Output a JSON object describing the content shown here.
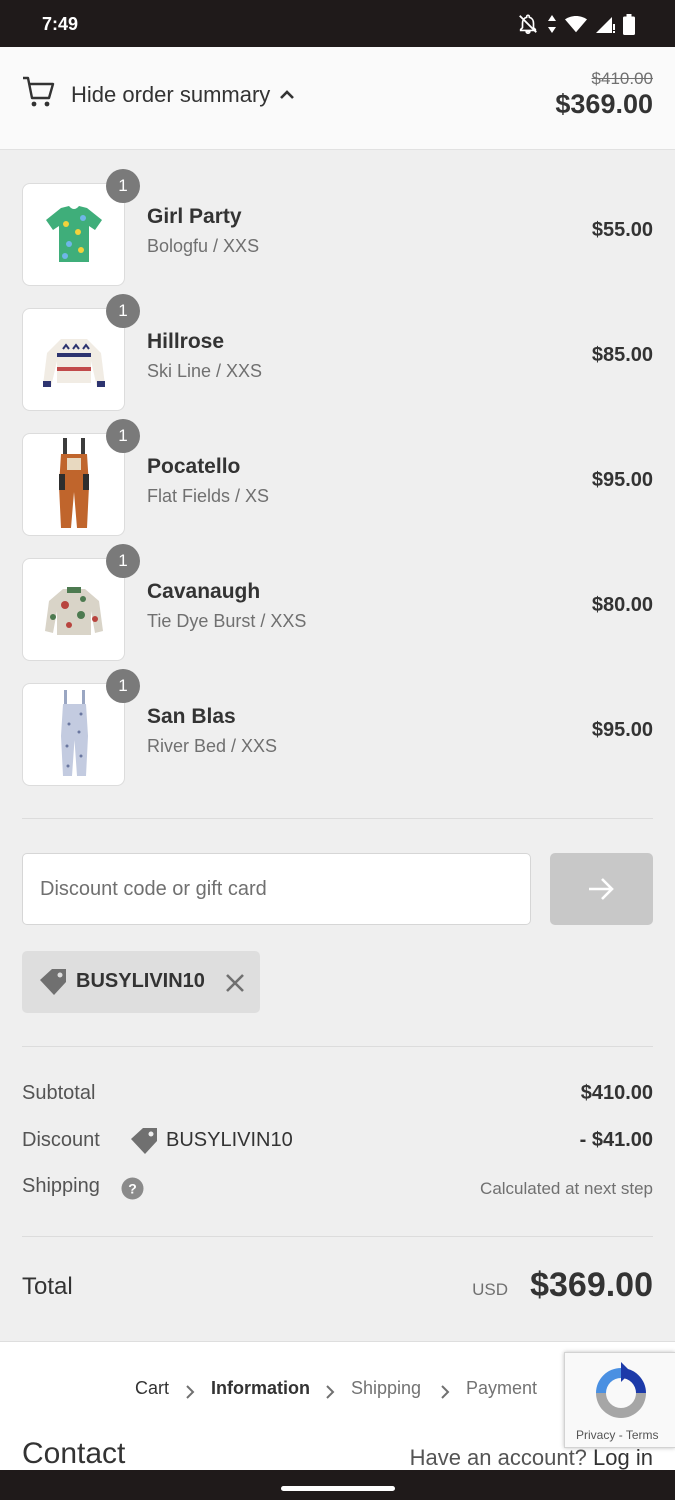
{
  "status_bar": {
    "time": "7:49"
  },
  "summary_toggle": {
    "label": "Hide order summary",
    "original_total": "$410.00",
    "total": "$369.00"
  },
  "items": [
    {
      "name": "Girl Party",
      "variant": "Bologfu / XXS",
      "price": "$55.00",
      "quantity": "1",
      "image": "shirt-image"
    },
    {
      "name": "Hillrose",
      "variant": "Ski Line / XXS",
      "price": "$85.00",
      "quantity": "1",
      "image": "sweater-image"
    },
    {
      "name": "Pocatello",
      "variant": "Flat Fields / XS",
      "price": "$95.00",
      "quantity": "1",
      "image": "overalls-image"
    },
    {
      "name": "Cavanaugh",
      "variant": "Tie Dye Burst / XXS",
      "price": "$80.00",
      "quantity": "1",
      "image": "fleece-image"
    },
    {
      "name": "San Blas",
      "variant": "River Bed / XXS",
      "price": "$95.00",
      "quantity": "1",
      "image": "denim-overalls-image"
    }
  ],
  "discount": {
    "placeholder": "Discount code or gift card",
    "applied_code": "BUSYLIVIN10"
  },
  "totals": {
    "subtotal_label": "Subtotal",
    "subtotal_value": "$410.00",
    "discount_label": "Discount",
    "discount_code": "BUSYLIVIN10",
    "discount_value": "- $41.00",
    "shipping_label": "Shipping",
    "shipping_value": "Calculated at next step",
    "total_label": "Total",
    "currency": "USD",
    "total_value": "$369.00"
  },
  "breadcrumb": {
    "cart": "Cart",
    "information": "Information",
    "shipping": "Shipping",
    "payment": "Payment"
  },
  "recaptcha": {
    "privacy": "Privacy",
    "separator": "-",
    "terms": "Terms"
  },
  "contact": {
    "title": "Contact",
    "account_prompt": "Have an account?",
    "login": "Log in"
  },
  "colors": {
    "status_bar": "#1f1a1a",
    "panel_background": "#efefef",
    "badge": "#7a7a7a",
    "apply_button_disabled": "#c8c8c8"
  }
}
